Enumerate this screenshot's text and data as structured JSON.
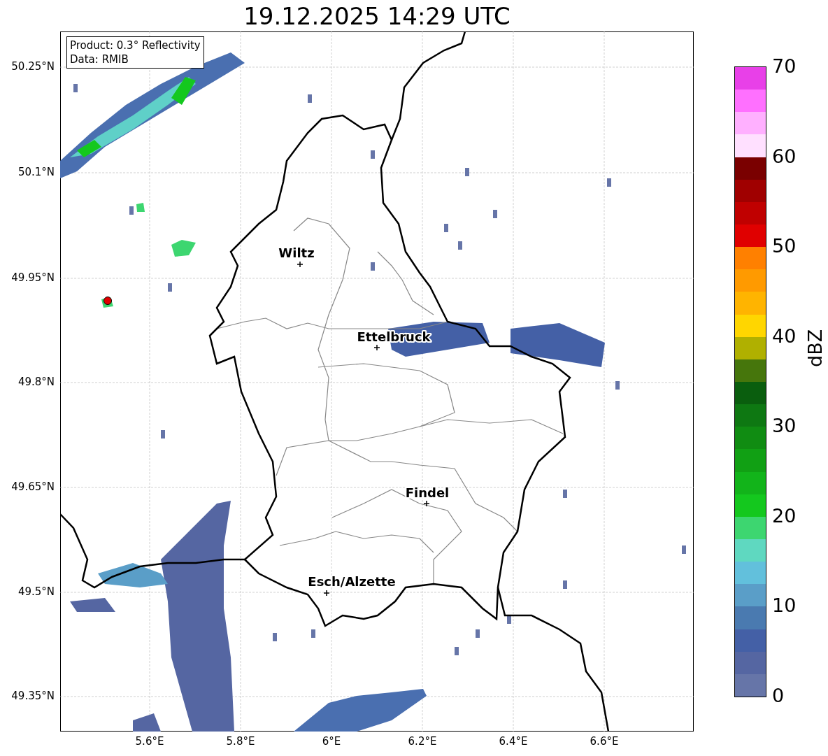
{
  "title": "19.12.2025 14:29 UTC",
  "info_box": {
    "lines": [
      "Product: 0.3° Reflectivity",
      "Data: RMIB"
    ]
  },
  "lat_ticks": [
    "50.25°N",
    "50.1°N",
    "49.95°N",
    "49.8°N",
    "49.65°N",
    "49.5°N",
    "49.35°N"
  ],
  "lon_ticks": [
    "5.6°E",
    "5.8°E",
    "6°E",
    "6.2°E",
    "6.4°E",
    "6.6°E"
  ],
  "cities": [
    {
      "name": "Wiltz"
    },
    {
      "name": "Ettelbruck"
    },
    {
      "name": "Findel"
    },
    {
      "name": "Esch/Alzette"
    }
  ],
  "colorbar": {
    "label": "dBZ",
    "ticks": [
      "70",
      "60",
      "50",
      "40",
      "30",
      "20",
      "10",
      "0"
    ],
    "bands": [
      {
        "color": "#6675a8"
      },
      {
        "color": "#5566a2"
      },
      {
        "color": "#4460a6"
      },
      {
        "color": "#4a7ab0"
      },
      {
        "color": "#5a9ec8"
      },
      {
        "color": "#62c0dc"
      },
      {
        "color": "#5fd8c0"
      },
      {
        "color": "#3dd670"
      },
      {
        "color": "#14c81e"
      },
      {
        "color": "#12b41a"
      },
      {
        "color": "#11a014"
      },
      {
        "color": "#108c12"
      },
      {
        "color": "#0e7812"
      },
      {
        "color": "#0a5e0e"
      },
      {
        "color": "#46760c"
      },
      {
        "color": "#b0b000"
      },
      {
        "color": "#ffd600"
      },
      {
        "color": "#ffb400"
      },
      {
        "color": "#ff9a00"
      },
      {
        "color": "#ff8000"
      },
      {
        "color": "#e00000"
      },
      {
        "color": "#c00000"
      },
      {
        "color": "#a00000"
      },
      {
        "color": "#7a0000"
      },
      {
        "color": "#ffe0ff"
      },
      {
        "color": "#ffb0ff"
      },
      {
        "color": "#ff70ff"
      },
      {
        "color": "#e840e8"
      }
    ]
  }
}
